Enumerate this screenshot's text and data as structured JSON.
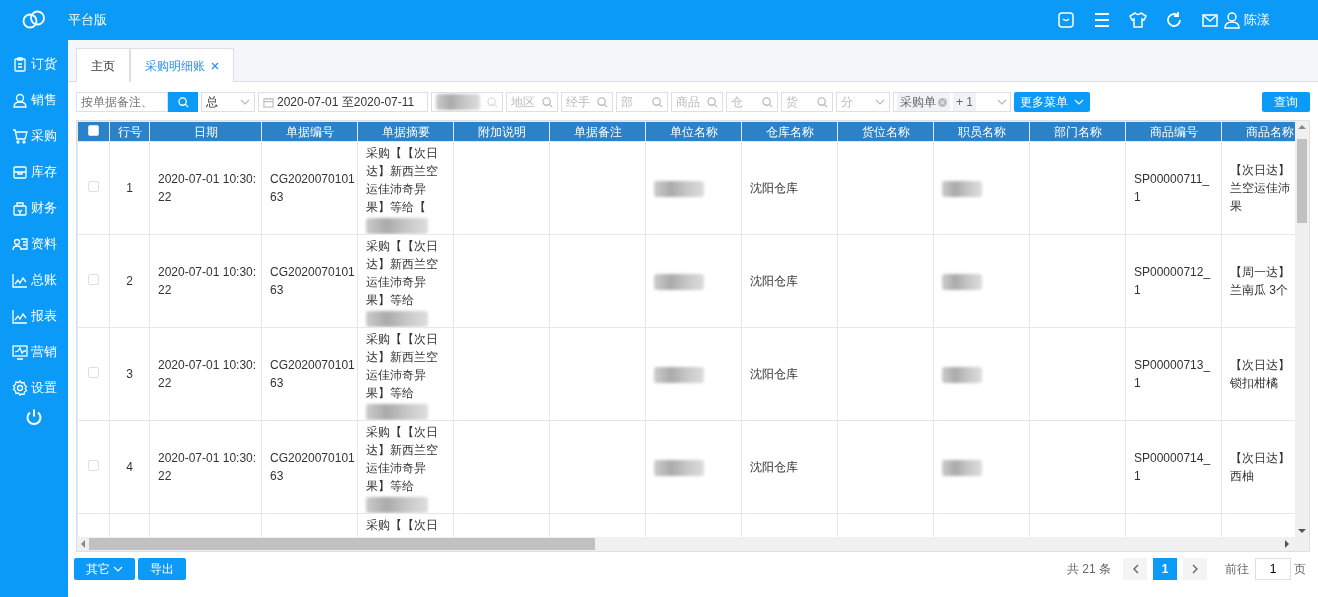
{
  "app": {
    "title": "平台版",
    "user": "陈漾"
  },
  "sidebar": {
    "items": [
      {
        "label": "订货"
      },
      {
        "label": "销售"
      },
      {
        "label": "采购"
      },
      {
        "label": "库存"
      },
      {
        "label": "财务"
      },
      {
        "label": "资料"
      },
      {
        "label": "总账"
      },
      {
        "label": "报表"
      },
      {
        "label": "营销"
      },
      {
        "label": "设置"
      }
    ]
  },
  "tabs": [
    {
      "label": "主页",
      "selected": false,
      "closable": false
    },
    {
      "label": "采购明细账",
      "selected": true,
      "closable": true
    }
  ],
  "filters": [
    {
      "kind": "search",
      "placeholder": "按单据备注、"
    },
    {
      "kind": "select",
      "value": "总"
    },
    {
      "kind": "date",
      "start": "2020-07-01",
      "separator": "至",
      "end": "2020-07-11"
    },
    {
      "kind": "redacted"
    },
    {
      "kind": "lookup",
      "placeholder": "地区"
    },
    {
      "kind": "lookup",
      "placeholder": "经手"
    },
    {
      "kind": "lookup",
      "placeholder": "部"
    },
    {
      "kind": "lookup",
      "placeholder": "商品"
    },
    {
      "kind": "lookup",
      "placeholder": "仓"
    },
    {
      "kind": "lookup",
      "placeholder": "货"
    },
    {
      "kind": "select",
      "placeholder": "分"
    },
    {
      "kind": "tags",
      "tags": [
        "采购单"
      ],
      "more": "+ 1"
    },
    {
      "kind": "menu",
      "label": "更多菜单"
    }
  ],
  "query_button": "查询",
  "table": {
    "header_checked": false,
    "columns": [
      "行号",
      "日期",
      "单据编号",
      "单据摘要",
      "附加说明",
      "单据备注",
      "单位名称",
      "仓库名称",
      "货位名称",
      "职员名称",
      "部门名称",
      "商品编号",
      "商品名称"
    ],
    "rows": [
      {
        "checked": false,
        "no": "1",
        "date": "2020-07-01 10:30:22",
        "code": "CG202007010163",
        "summary": "采购【【次日达】新西兰空运佳沛奇异果】等给【",
        "summary_redacted": true,
        "unit_redacted": true,
        "warehouse": "沈阳仓库",
        "staff_redacted": true,
        "product_code": "SP00000711_1",
        "product_name": [
          "【次日达】",
          "兰空运佳沛",
          "果"
        ]
      },
      {
        "checked": false,
        "no": "2",
        "date": "2020-07-01 10:30:22",
        "code": "CG202007010163",
        "summary": "采购【【次日达】新西兰空运佳沛奇异果】等给",
        "summary_redacted": true,
        "unit_redacted": true,
        "warehouse": "沈阳仓库",
        "staff_redacted": true,
        "product_code": "SP00000712_1",
        "product_name": [
          "【周一达】",
          "兰南瓜 3个"
        ]
      },
      {
        "checked": false,
        "no": "3",
        "date": "2020-07-01 10:30:22",
        "code": "CG202007010163",
        "summary": "采购【【次日达】新西兰空运佳沛奇异果】等给",
        "summary_redacted": true,
        "unit_redacted": true,
        "warehouse": "沈阳仓库",
        "staff_redacted": true,
        "product_code": "SP00000713_1",
        "product_name": [
          "【次日达】",
          "锁扣柑橘"
        ]
      },
      {
        "checked": false,
        "no": "4",
        "date": "2020-07-01 10:30:22",
        "code": "CG202007010163",
        "summary": "采购【【次日达】新西兰空运佳沛奇异果】等给",
        "summary_redacted": true,
        "unit_redacted": true,
        "warehouse": "沈阳仓库",
        "staff_redacted": true,
        "product_code": "SP00000714_1",
        "product_name": [
          "【次日达】",
          "西柚"
        ]
      },
      {
        "summary": "采购【【次日"
      }
    ]
  },
  "footer": {
    "buttons": [
      {
        "label": "其它",
        "dropdown": true
      },
      {
        "label": "导出",
        "dropdown": false
      }
    ],
    "total": "共 21 条",
    "pages": [
      {
        "label": "1",
        "selected": true
      }
    ],
    "goto_label": "前往",
    "goto_value": "1",
    "goto_suffix": "页"
  }
}
